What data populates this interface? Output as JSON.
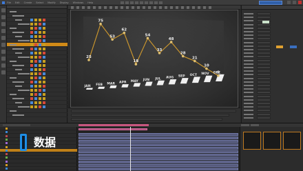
{
  "window": {
    "title": ""
  },
  "menu": [
    "File",
    "Edit",
    "Create",
    "Select",
    "Modify",
    "Display",
    "Windows",
    "Help"
  ],
  "overlay": {
    "logo_text": "数据"
  },
  "chart_data": {
    "type": "line",
    "categories": [
      "JAN",
      "FEB",
      "MAR",
      "APR",
      "MAY",
      "JUN",
      "JUL",
      "AUG",
      "SEP",
      "OCT",
      "NOV",
      "DEC"
    ],
    "values": [
      25,
      75,
      53,
      62,
      18,
      54,
      33,
      48,
      28,
      21,
      10,
      0
    ],
    "series_color": "#c9952e",
    "bar_color": "#f0f0f0"
  },
  "colors": {
    "accent": "#d08a18",
    "selection_blue": "#2f5fa8",
    "track": "#55597a",
    "track_pink": "#a84b78",
    "logo_blue": "#1e8ee6"
  }
}
